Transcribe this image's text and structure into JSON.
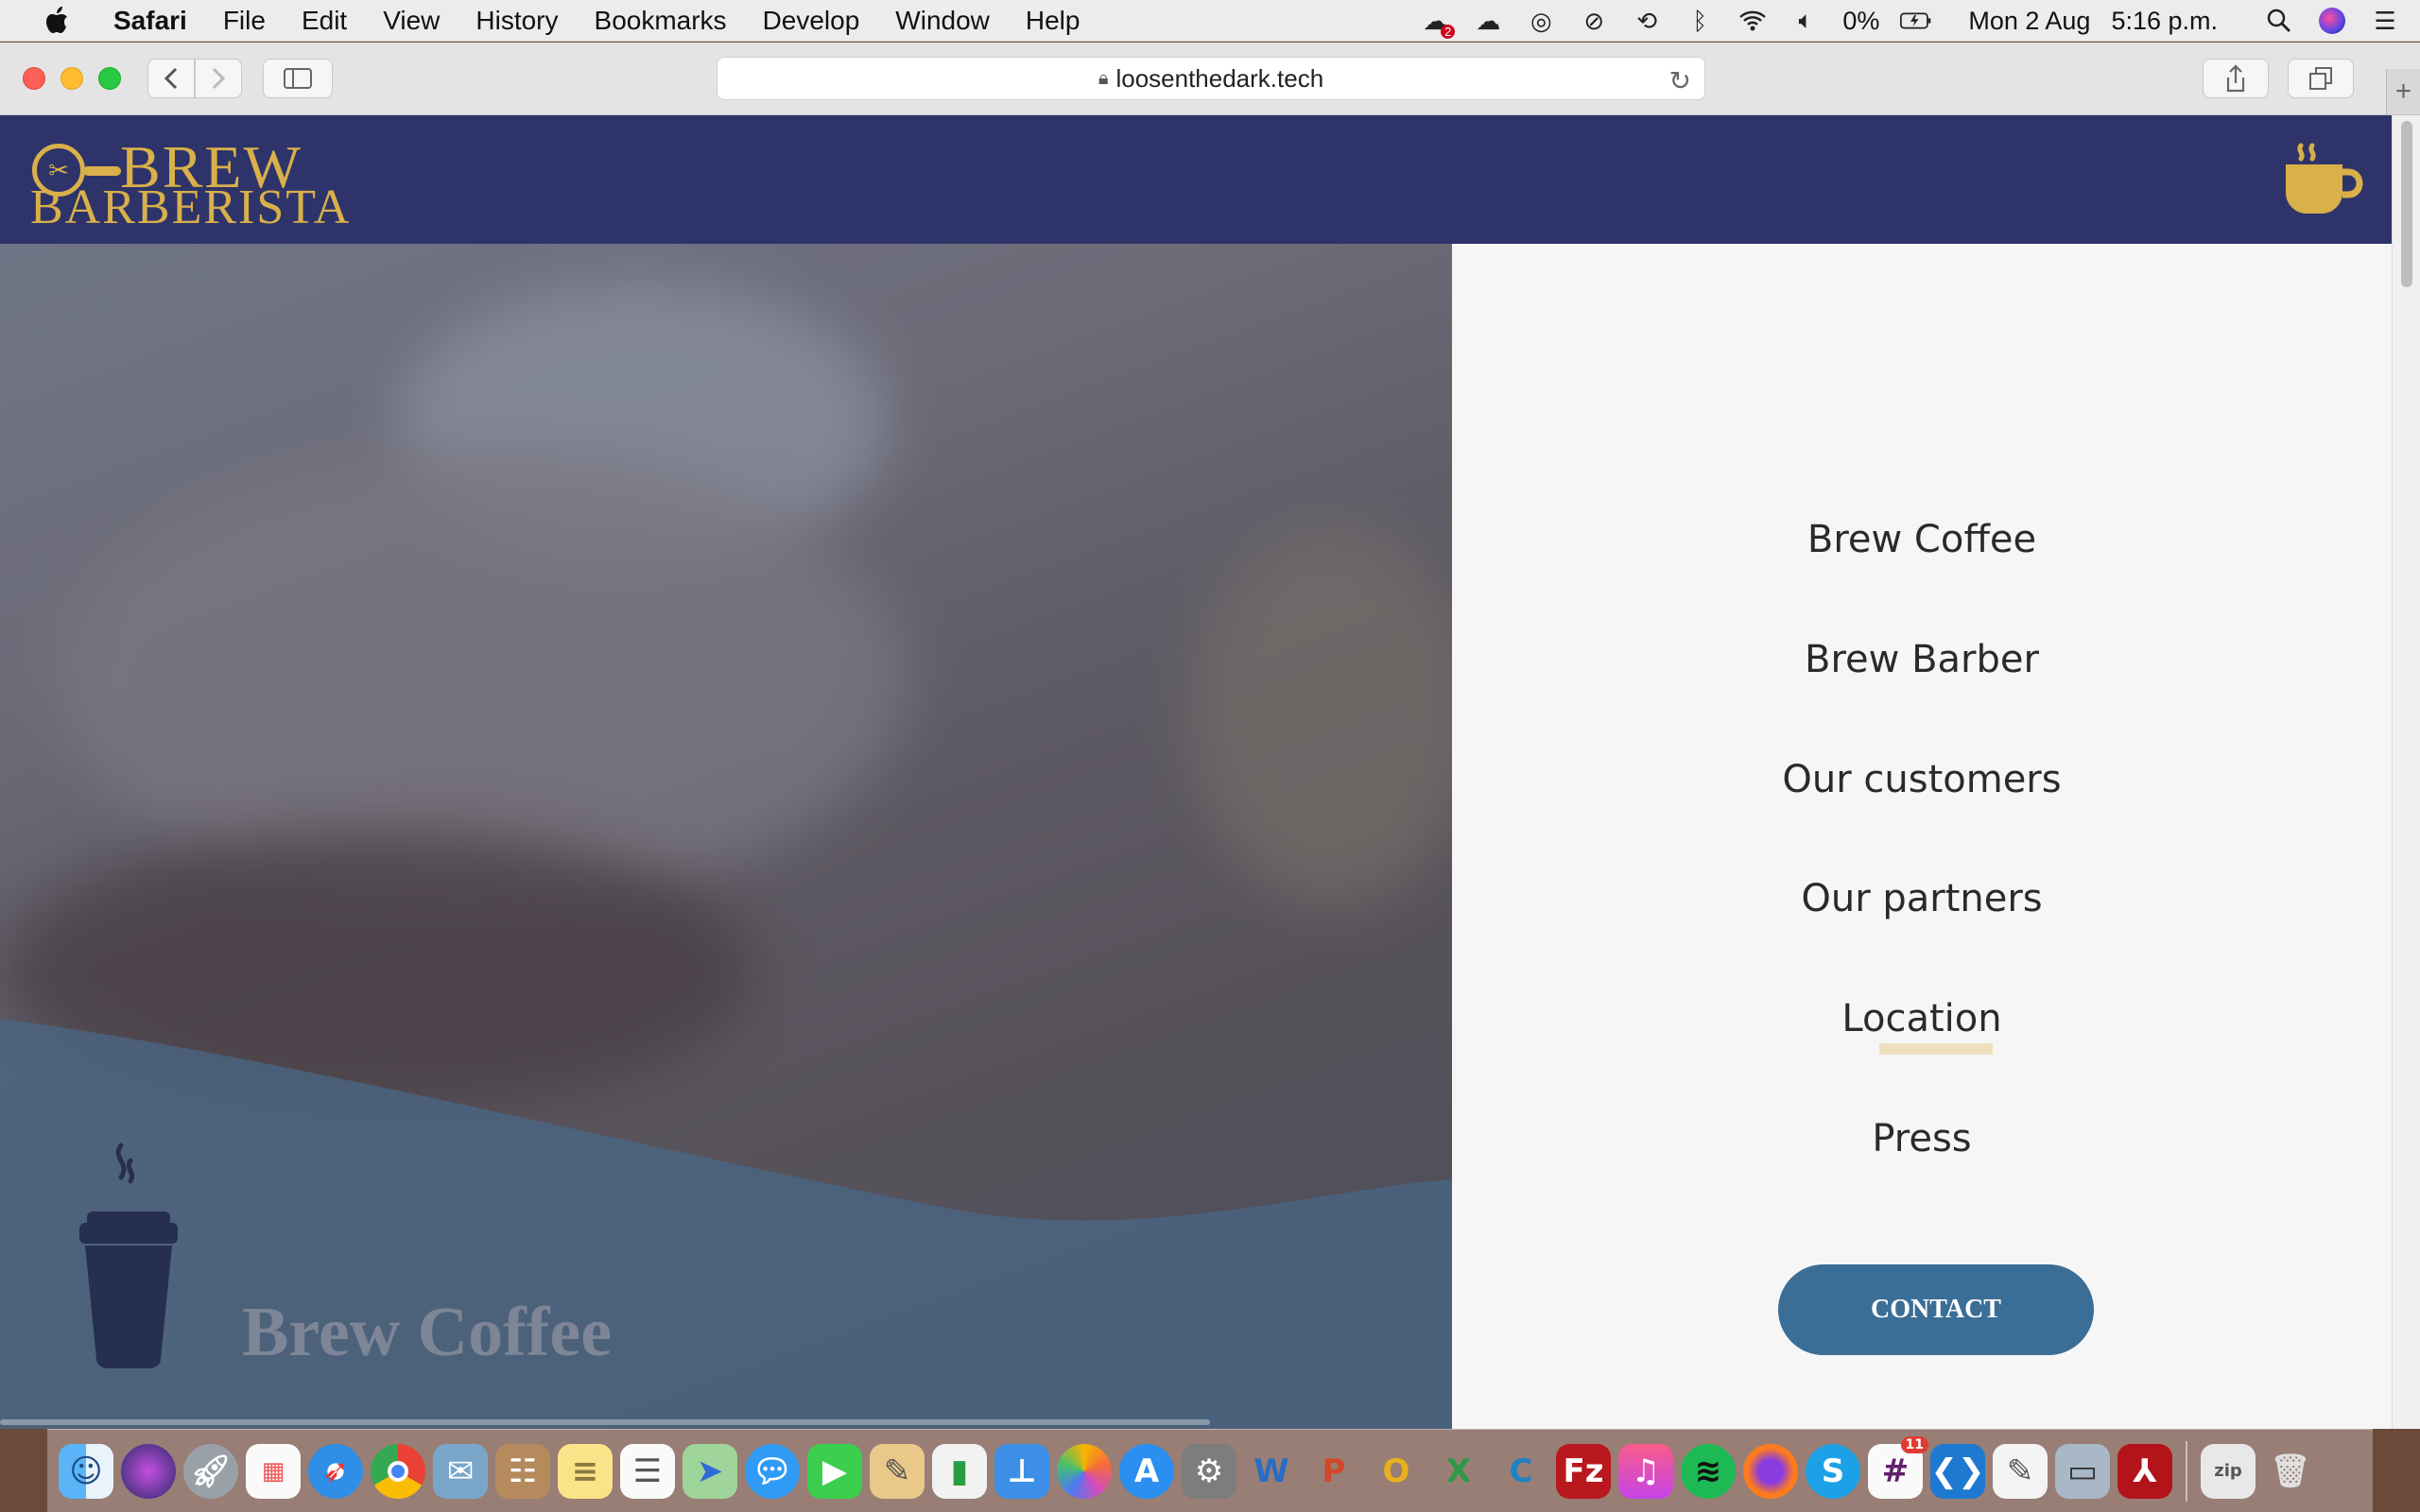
{
  "menubar": {
    "app_name": "Safari",
    "items": [
      "File",
      "Edit",
      "View",
      "History",
      "Bookmarks",
      "Develop",
      "Window",
      "Help"
    ],
    "battery_percent": "0%",
    "date": "Mon 2 Aug",
    "time": "5:16 p.m.",
    "cloud_badge": "2"
  },
  "browser": {
    "url": "loosenthedark.tech"
  },
  "site": {
    "logo_line1": "BREW",
    "logo_line2": "BARBERISTA",
    "hero_title": "Brew Coffee",
    "menu": [
      "Brew Coffee",
      "Brew Barber",
      "Our customers",
      "Our partners",
      "Location",
      "Press"
    ],
    "contact_label": "CONTACT",
    "colors": {
      "header_bg": "#2e346a",
      "gold": "#d9b049",
      "contact_bg": "#3a6e96",
      "menu_bg": "#f6f6f6"
    }
  },
  "dock": {
    "icons": [
      "finder-icon",
      "siri-icon",
      "launchpad-icon",
      "apps-grid-icon",
      "safari-icon",
      "chrome-icon",
      "mail-icon",
      "contacts-icon",
      "notes-icon",
      "reminders-icon",
      "maps-icon",
      "messages-icon",
      "facetime-icon",
      "preview-icon",
      "numbers-icon",
      "keynote-icon",
      "photos-icon",
      "app-store-icon",
      "system-preferences-icon",
      "word-icon",
      "powerpoint-icon",
      "outlook-icon",
      "excel-icon",
      "codekit-icon",
      "filezilla-icon",
      "music-icon",
      "spotify-icon",
      "firefox-icon",
      "skype-icon",
      "slack-icon",
      "vscode-icon",
      "textedit-icon",
      "screenshot-icon",
      "acrobat-icon",
      "archive-icon",
      "trash-icon"
    ],
    "slack_badge": "11"
  }
}
